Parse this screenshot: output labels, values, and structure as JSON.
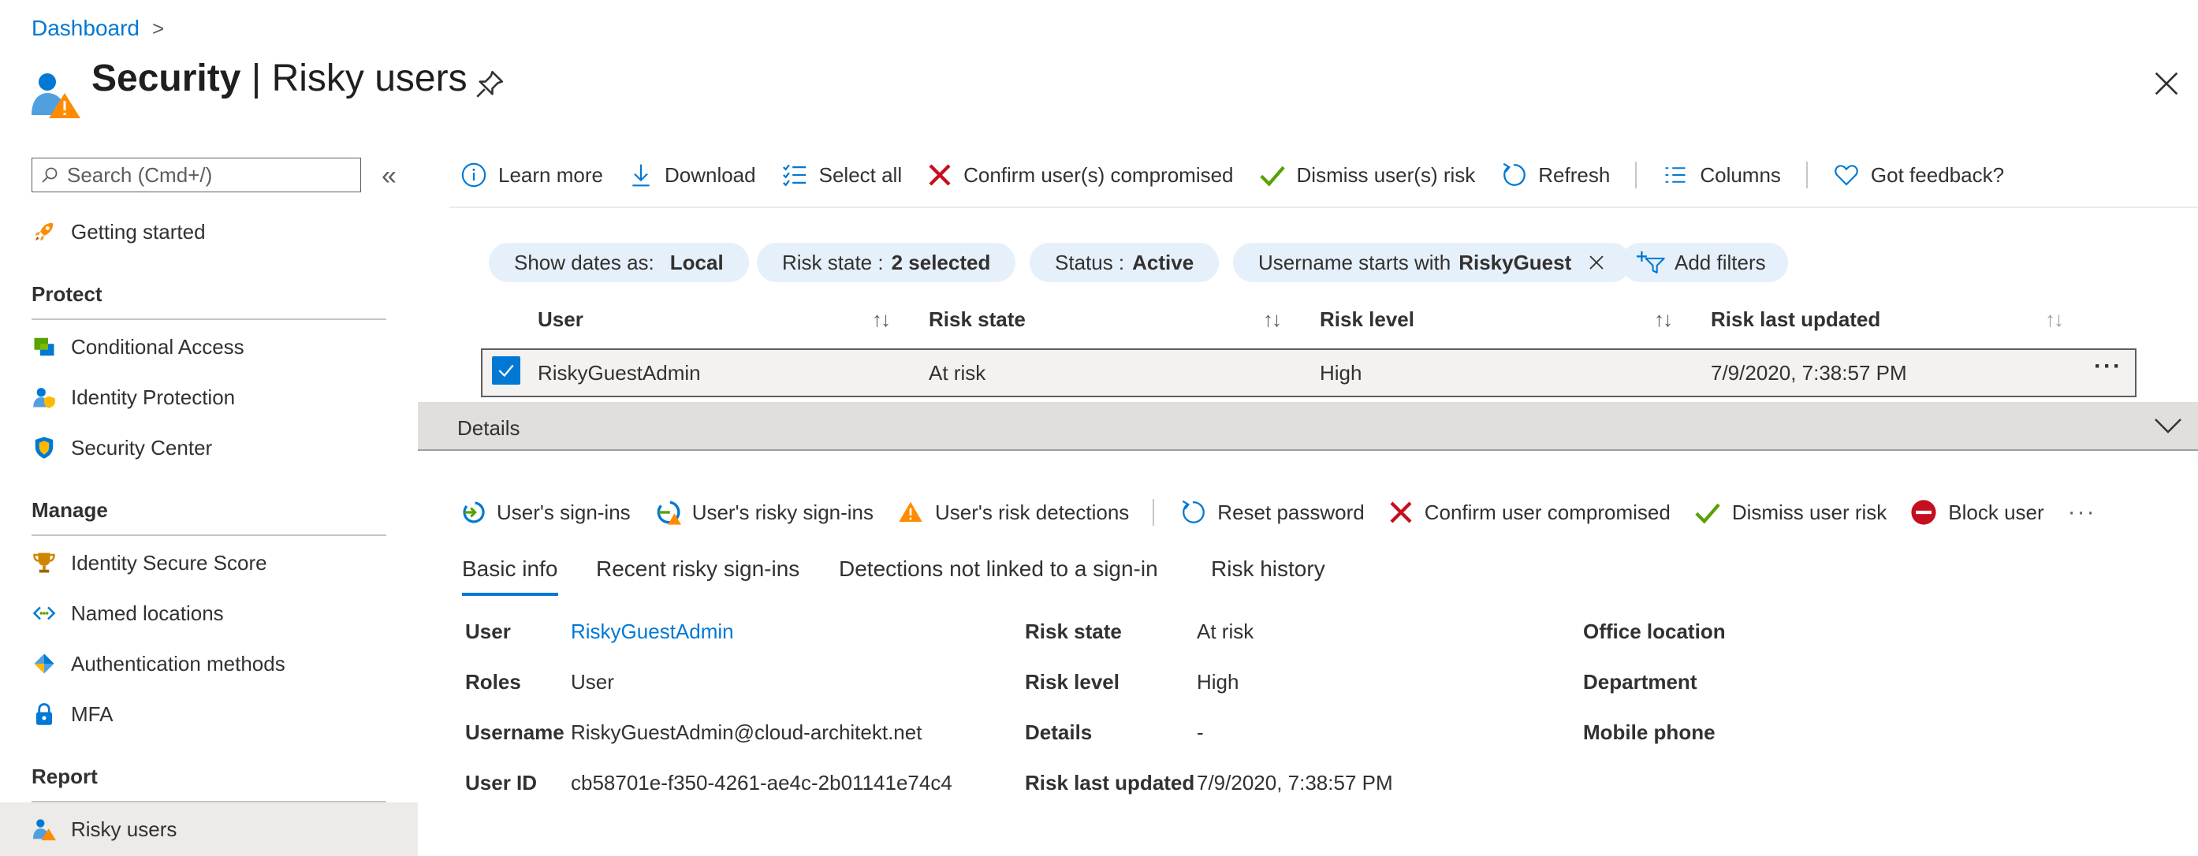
{
  "breadcrumb": {
    "root": "Dashboard",
    "separator": ">"
  },
  "header": {
    "title_bold": "Security",
    "title_sep": " | ",
    "title_rest": "Risky users",
    "icons": {
      "pin": "pin-icon",
      "close": "close-icon",
      "page": "risky-user-icon"
    }
  },
  "sidebar": {
    "search_placeholder": "Search (Cmd+/)",
    "collapse_glyph": "«",
    "getting_started": "Getting started",
    "sections": [
      {
        "title": "Protect",
        "items": [
          "Conditional Access",
          "Identity Protection",
          "Security Center"
        ]
      },
      {
        "title": "Manage",
        "items": [
          "Identity Secure Score",
          "Named locations",
          "Authentication methods",
          "MFA"
        ]
      },
      {
        "title": "Report",
        "items": [
          "Risky users"
        ]
      }
    ],
    "selected": "Risky users"
  },
  "toolbar": {
    "learn_more": "Learn more",
    "download": "Download",
    "select_all": "Select all",
    "confirm_compromised": "Confirm user(s) compromised",
    "dismiss_risk": "Dismiss user(s) risk",
    "refresh": "Refresh",
    "columns": "Columns",
    "feedback": "Got feedback?"
  },
  "filters": {
    "dates_label": "Show dates as:",
    "dates_value": "Local",
    "risk_state_label": "Risk state :",
    "risk_state_value": "2 selected",
    "status_label": "Status :",
    "status_value": "Active",
    "username_label": "Username starts with",
    "username_value": "RiskyGuest",
    "add_filters": "Add filters"
  },
  "grid": {
    "columns": [
      "User",
      "Risk state",
      "Risk level",
      "Risk last updated"
    ],
    "sort_glyph": "↑↓",
    "rows": [
      {
        "user": "RiskyGuestAdmin",
        "risk_state": "At risk",
        "risk_level": "High",
        "risk_last_updated": "7/9/2020, 7:38:57 PM",
        "selected": true
      }
    ],
    "row_more": "···"
  },
  "details": {
    "label": "Details",
    "toolbar": {
      "sign_ins": "User's sign-ins",
      "risky_sign_ins": "User's risky sign-ins",
      "risk_detections": "User's risk detections",
      "reset_password": "Reset password",
      "confirm_compromised": "Confirm user compromised",
      "dismiss_risk": "Dismiss user risk",
      "block_user": "Block user",
      "more": "···"
    },
    "tabs": [
      "Basic info",
      "Recent risky sign-ins",
      "Detections not linked to a sign-in",
      "Risk history"
    ],
    "active_tab": "Basic info",
    "info": {
      "user_label": "User",
      "user_value": "RiskyGuestAdmin",
      "roles_label": "Roles",
      "roles_value": "User",
      "username_label": "Username",
      "username_value": "RiskyGuestAdmin@cloud-architekt.net",
      "userid_label": "User ID",
      "userid_value": "cb58701e-f350-4261-ae4c-2b01141e74c4",
      "risk_state_label": "Risk state",
      "risk_state_value": "At risk",
      "risk_level_label": "Risk level",
      "risk_level_value": "High",
      "details_label": "Details",
      "details_value": "-",
      "risk_updated_label": "Risk last updated",
      "risk_updated_value": "7/9/2020, 7:38:57 PM",
      "office_label": "Office location",
      "department_label": "Department",
      "mobile_label": "Mobile phone"
    }
  },
  "colors": {
    "accent": "#0078d4",
    "danger": "#c50f1f",
    "success": "#57a300",
    "warning": "#ff8c00",
    "pill": "#e6f0fa"
  }
}
